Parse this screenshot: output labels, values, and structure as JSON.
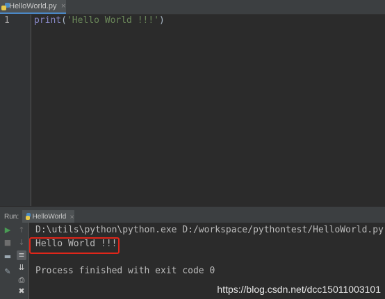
{
  "editor_tab": {
    "label": "HelloWorld.py",
    "close": "×"
  },
  "editor": {
    "line_number": "1",
    "code": {
      "func": "print",
      "open": "(",
      "string": "'Hello World !!!'",
      "close": ")"
    }
  },
  "run_panel": {
    "label": "Run:",
    "tab_label": "HelloWorld",
    "tab_close": "×"
  },
  "console": {
    "command": "D:\\utils\\python\\python.exe D:/workspace/pythontest/HelloWorld.py",
    "output": "Hello World !!!",
    "exit_message": "Process finished with exit code 0"
  },
  "watermark": "https://blog.csdn.net/dcc15011003101",
  "colors": {
    "highlight_border": "#e0261a",
    "run_green": "#499c54",
    "keyword": "#8888c6",
    "string": "#6a8759"
  },
  "icons": [
    "python-file-icon",
    "run-icon",
    "stop-icon",
    "up-arrow-icon",
    "down-arrow-icon",
    "layout-icon",
    "soft-wrap-icon",
    "pin-icon",
    "scroll-to-end-icon",
    "print-icon",
    "trash-icon"
  ]
}
